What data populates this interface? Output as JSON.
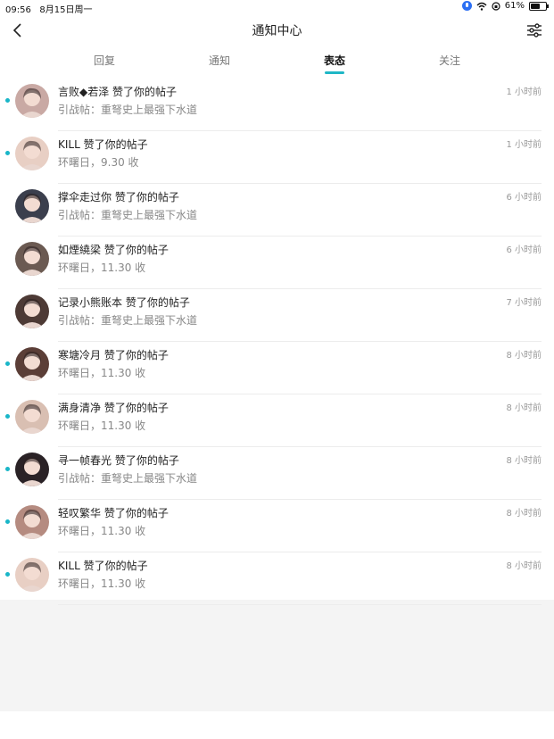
{
  "status_bar": {
    "time": "09:56",
    "date": "8月15日周一",
    "battery": "61%",
    "battery_level": 0.61
  },
  "header": {
    "title": "通知中心",
    "back_icon": "chevron-left-icon",
    "filter_icon": "sliders-icon"
  },
  "tabs": [
    {
      "label": "回复",
      "active": false
    },
    {
      "label": "通知",
      "active": false
    },
    {
      "label": "表态",
      "active": true
    },
    {
      "label": "关注",
      "active": false
    }
  ],
  "accent_color": "#1fb7c6",
  "notifications": [
    {
      "name": "言败◆若泽 赞了你的帖子",
      "sub": "引战帖：重弩史上最强下水道",
      "time": "1 小时前",
      "unread": true,
      "avatar_color": "#c9a9a4"
    },
    {
      "name": "KILL 赞了你的帖子",
      "sub": "环曙日，9.30 收",
      "time": "1 小时前",
      "unread": true,
      "avatar_color": "#e8cfc4"
    },
    {
      "name": "撑伞走过你 赞了你的帖子",
      "sub": "引战帖：重弩史上最强下水道",
      "time": "6 小时前",
      "unread": false,
      "avatar_color": "#3b3f4d"
    },
    {
      "name": "如煙繞梁 赞了你的帖子",
      "sub": "环曙日，11.30 收",
      "time": "6 小时前",
      "unread": false,
      "avatar_color": "#6b5a52"
    },
    {
      "name": "记录小熊账本 赞了你的帖子",
      "sub": "引战帖：重弩史上最强下水道",
      "time": "7 小时前",
      "unread": false,
      "avatar_color": "#4d3a35"
    },
    {
      "name": "寒塘冷月 赞了你的帖子",
      "sub": "环曙日，11.30 收",
      "time": "8 小时前",
      "unread": true,
      "avatar_color": "#5b3e37"
    },
    {
      "name": "满身清净 赞了你的帖子",
      "sub": "环曙日，11.30 收",
      "time": "8 小时前",
      "unread": true,
      "avatar_color": "#d9bfb2"
    },
    {
      "name": "寻一帧春光 赞了你的帖子",
      "sub": "引战帖：重弩史上最强下水道",
      "time": "8 小时前",
      "unread": true,
      "avatar_color": "#2a2226"
    },
    {
      "name": "轻叹繁华 赞了你的帖子",
      "sub": "环曙日，11.30 收",
      "time": "8 小时前",
      "unread": true,
      "avatar_color": "#b58b80"
    },
    {
      "name": "KILL 赞了你的帖子",
      "sub": "环曙日，11.30 收",
      "time": "8 小时前",
      "unread": true,
      "avatar_color": "#e8cfc4"
    }
  ]
}
